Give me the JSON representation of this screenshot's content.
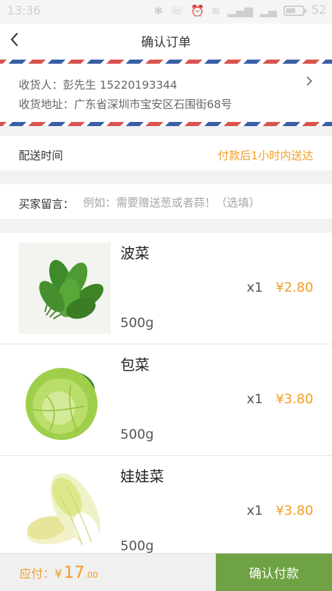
{
  "status_bar": {
    "time": "13:36",
    "battery": "52",
    "icons": [
      "bluetooth-icon",
      "phone-icon",
      "alarm-icon",
      "wifi-icon",
      "signal-icon",
      "signal-icon-2",
      "battery-icon"
    ]
  },
  "header": {
    "title": "确认订单",
    "back_icon": "chevron-left-icon"
  },
  "address": {
    "receiver_label": "收货人：",
    "receiver_name": "彭先生",
    "phone": "15220193344",
    "address_label": "收货地址：",
    "address_value": "广东省深圳市宝安区石围街68号",
    "arrow_icon": "chevron-right-icon"
  },
  "delivery": {
    "label": "配送时间",
    "value": "付款后1小时内送达"
  },
  "remark": {
    "label": "买家留言：",
    "placeholder": "例如：需要赠送葱或者蒜！（选填）"
  },
  "products": [
    {
      "name": "波菜",
      "weight": "500g",
      "quantity": "x1",
      "price": "¥2.80",
      "image": "spinach-image"
    },
    {
      "name": "包菜",
      "weight": "500g",
      "quantity": "x1",
      "price": "¥3.80",
      "image": "cabbage-image"
    },
    {
      "name": "娃娃菜",
      "weight": "500g",
      "quantity": "x1",
      "price": "¥3.80",
      "image": "baby-cabbage-image"
    }
  ],
  "footer": {
    "pay_label": "应付：",
    "currency": "¥",
    "amount_int": "17",
    "amount_dec": ".00",
    "confirm_label": "确认付款"
  },
  "colors": {
    "accent": "#f39c25",
    "confirm_button": "#6fa244",
    "airmail_red": "#d9544f",
    "airmail_blue": "#3a5fa5"
  }
}
